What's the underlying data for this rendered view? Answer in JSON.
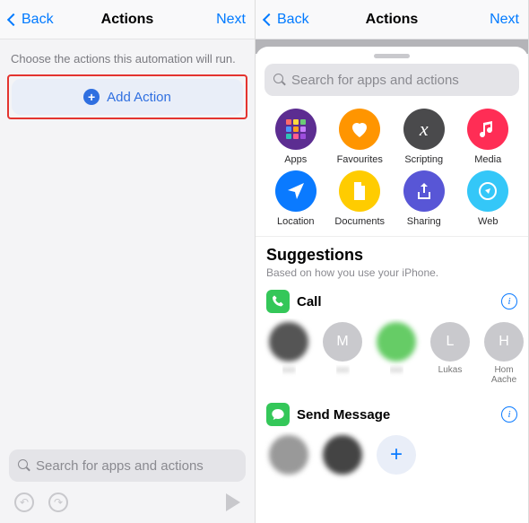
{
  "nav": {
    "back": "Back",
    "title": "Actions",
    "next": "Next"
  },
  "left": {
    "helper": "Choose the actions this automation will run.",
    "add_action": "Add Action",
    "search_placeholder": "Search for apps and actions"
  },
  "right": {
    "search_placeholder": "Search for apps and actions",
    "categories": [
      {
        "label": "Apps"
      },
      {
        "label": "Favourites"
      },
      {
        "label": "Scripting"
      },
      {
        "label": "Media"
      },
      {
        "label": "Location"
      },
      {
        "label": "Documents"
      },
      {
        "label": "Sharing"
      },
      {
        "label": "Web"
      }
    ],
    "suggestions_title": "Suggestions",
    "suggestions_sub": "Based on how you use your iPhone.",
    "row_call": "Call",
    "row_send": "Send Message",
    "contacts": [
      {
        "initial": "",
        "name": ""
      },
      {
        "initial": "M",
        "name": ""
      },
      {
        "initial": "",
        "name": ""
      },
      {
        "initial": "L",
        "name": "Lukas"
      },
      {
        "initial": "H",
        "name": "Hom Aache"
      }
    ]
  }
}
